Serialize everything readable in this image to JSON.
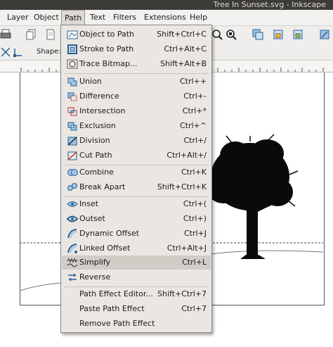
{
  "window": {
    "title": "Tree In Sunset.svg - Inkscape"
  },
  "menubar": {
    "items": [
      "Layer",
      "Object",
      "Path",
      "Text",
      "Filters",
      "Extensions",
      "Help"
    ]
  },
  "command_bar": {
    "shape_label": "Shape:"
  },
  "path_menu": {
    "items": [
      {
        "label": "Object to Path",
        "shortcut": "Shift+Ctrl+C"
      },
      {
        "label": "Stroke to Path",
        "shortcut": "Ctrl+Alt+C"
      },
      {
        "label": "Trace Bitmap...",
        "shortcut": "Shift+Alt+B"
      },
      {
        "label": "Union",
        "shortcut": "Ctrl++"
      },
      {
        "label": "Difference",
        "shortcut": "Ctrl+-"
      },
      {
        "label": "Intersection",
        "shortcut": "Ctrl+*"
      },
      {
        "label": "Exclusion",
        "shortcut": "Ctrl+^"
      },
      {
        "label": "Division",
        "shortcut": "Ctrl+/"
      },
      {
        "label": "Cut Path",
        "shortcut": "Ctrl+Alt+/"
      },
      {
        "label": "Combine",
        "shortcut": "Ctrl+K"
      },
      {
        "label": "Break Apart",
        "shortcut": "Shift+Ctrl+K"
      },
      {
        "label": "Inset",
        "shortcut": "Ctrl+("
      },
      {
        "label": "Outset",
        "shortcut": "Ctrl+)"
      },
      {
        "label": "Dynamic Offset",
        "shortcut": "Ctrl+J"
      },
      {
        "label": "Linked Offset",
        "shortcut": "Ctrl+Alt+J"
      },
      {
        "label": "Simplify",
        "shortcut": "Ctrl+L"
      },
      {
        "label": "Reverse",
        "shortcut": ""
      },
      {
        "label": "Path Effect Editor...",
        "shortcut": "Shift+Ctrl+7"
      },
      {
        "label": "Paste Path Effect",
        "shortcut": "Ctrl+7"
      },
      {
        "label": "Remove Path Effect",
        "shortcut": ""
      }
    ]
  }
}
